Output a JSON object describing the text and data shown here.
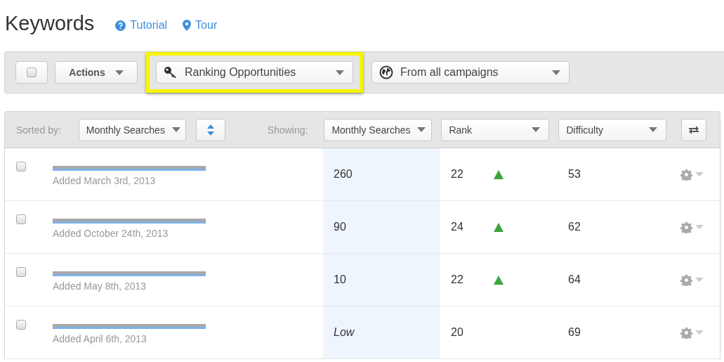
{
  "page": {
    "title": "Keywords",
    "links": [
      {
        "kind": "help",
        "label": "Tutorial"
      },
      {
        "kind": "pin",
        "label": "Tour"
      }
    ]
  },
  "toolbar": {
    "select_all": {
      "checked": false
    },
    "actions_label": "Actions",
    "filters": [
      {
        "kind": "key",
        "label": "Ranking Opportunities",
        "highlighted": true
      },
      {
        "kind": "globe",
        "label": "From all campaigns",
        "highlighted": false
      }
    ]
  },
  "table": {
    "sorted_by_label": "Sorted by:",
    "sorted_by": "Monthly Searches",
    "showing_label": "Showing:",
    "columns": [
      "Monthly Searches",
      "Rank",
      "Difficulty"
    ],
    "rows": [
      {
        "checked": false,
        "added": "Added March 3rd, 2013",
        "searches": "260",
        "searches_italic": false,
        "rank": "22",
        "rank_up": true,
        "difficulty": "53"
      },
      {
        "checked": false,
        "added": "Added October 24th, 2013",
        "searches": "90",
        "searches_italic": false,
        "rank": "24",
        "rank_up": true,
        "difficulty": "62"
      },
      {
        "checked": false,
        "added": "Added May 8th, 2013",
        "searches": "10",
        "searches_italic": false,
        "rank": "22",
        "rank_up": true,
        "difficulty": "64"
      },
      {
        "checked": false,
        "added": "Added April 6th, 2013",
        "searches": "Low",
        "searches_italic": true,
        "rank": "20",
        "rank_up": false,
        "difficulty": "69"
      }
    ]
  }
}
